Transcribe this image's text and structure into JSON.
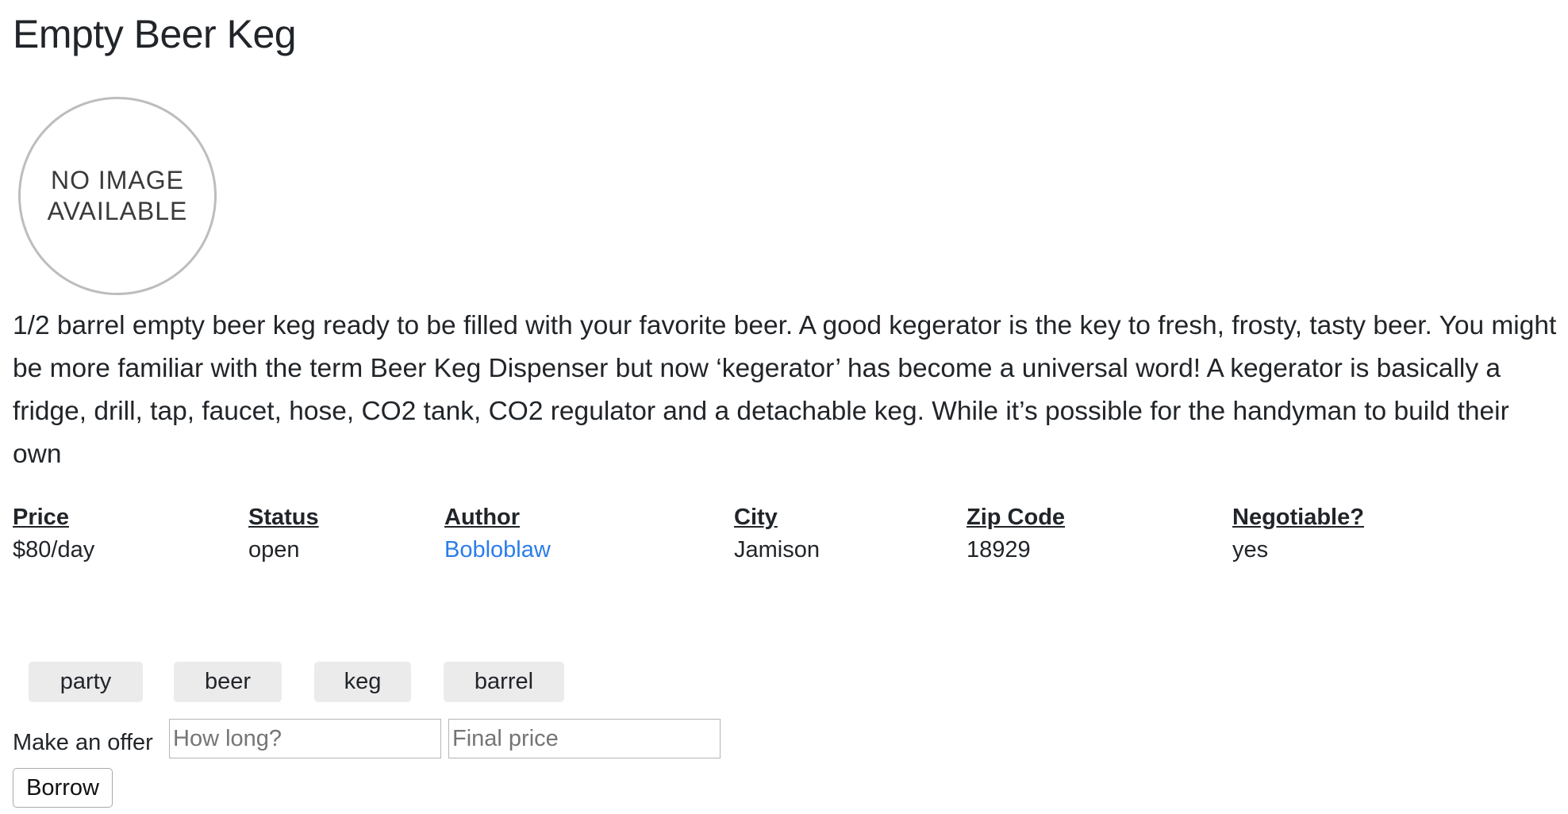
{
  "listing": {
    "title": "Empty Beer Keg",
    "image_placeholder": {
      "line1": "NO IMAGE",
      "line2": "AVAILABLE"
    },
    "description": "1/2 barrel empty beer keg ready to be filled with your favorite beer. A good kegerator is the key to fresh, frosty, tasty beer. You might be more familiar with the term Beer Keg Dispenser but now ‘kegerator’ has become a universal word! A kegerator is basically a fridge, drill, tap, faucet, hose, CO2 tank, CO2 regulator and a detachable keg. While it’s possible for the handyman to build their own"
  },
  "details": {
    "price": {
      "label": "Price",
      "value": "$80/day"
    },
    "status": {
      "label": "Status",
      "value": "open"
    },
    "author": {
      "label": "Author",
      "value": "Bobloblaw"
    },
    "city": {
      "label": "City",
      "value": "Jamison"
    },
    "zip": {
      "label": "Zip Code",
      "value": "18929"
    },
    "negotiable": {
      "label": "Negotiable?",
      "value": "yes"
    }
  },
  "tags": [
    "party",
    "beer",
    "keg",
    "barrel"
  ],
  "offer": {
    "label": "Make an offer",
    "duration_placeholder": "How long?",
    "price_placeholder": "Final price",
    "submit_label": "Borrow"
  },
  "colors": {
    "link": "#2b7de9",
    "tag_background": "#ebebeb",
    "text": "#212529"
  }
}
